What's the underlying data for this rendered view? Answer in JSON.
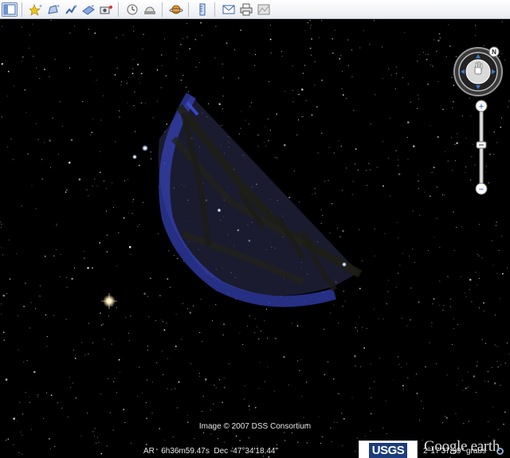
{
  "toolbar": {
    "buttons": [
      {
        "name": "sidebar-toggle-button",
        "icon": "sidebar-icon",
        "active": true
      },
      {
        "name": "add-placemark-button",
        "icon": "placemark-pin-icon"
      },
      {
        "name": "add-polygon-button",
        "icon": "polygon-icon"
      },
      {
        "name": "add-path-button",
        "icon": "path-icon"
      },
      {
        "name": "add-image-overlay-button",
        "icon": "image-overlay-icon"
      },
      {
        "name": "record-tour-button",
        "icon": "camera-icon"
      },
      {
        "name": "historical-imagery-button",
        "icon": "clock-icon"
      },
      {
        "name": "sunlight-button",
        "icon": "sunlight-icon"
      },
      {
        "name": "switch-planet-button",
        "icon": "planet-icon"
      },
      {
        "name": "ruler-button",
        "icon": "ruler-icon"
      },
      {
        "name": "email-button",
        "icon": "email-icon"
      },
      {
        "name": "print-button",
        "icon": "print-icon"
      },
      {
        "name": "view-in-maps-button",
        "icon": "maps-icon"
      }
    ]
  },
  "navigation": {
    "north_label": "N",
    "zoom_in_label": "+",
    "zoom_out_label": "−"
  },
  "credit": "Image © 2007 DSS Consortium",
  "usgs_label": "USGS",
  "logo": "Google earth",
  "status_bar": {
    "coordinates": "AR   6h36m59.47s  Dec -47°34'18.44\"",
    "view_angle": "2°17'37.99\" graus"
  },
  "colors": {
    "sky": "#000000",
    "overlay_blue": "#3a4fd0",
    "toolbar_bg": "#eef1f5"
  }
}
